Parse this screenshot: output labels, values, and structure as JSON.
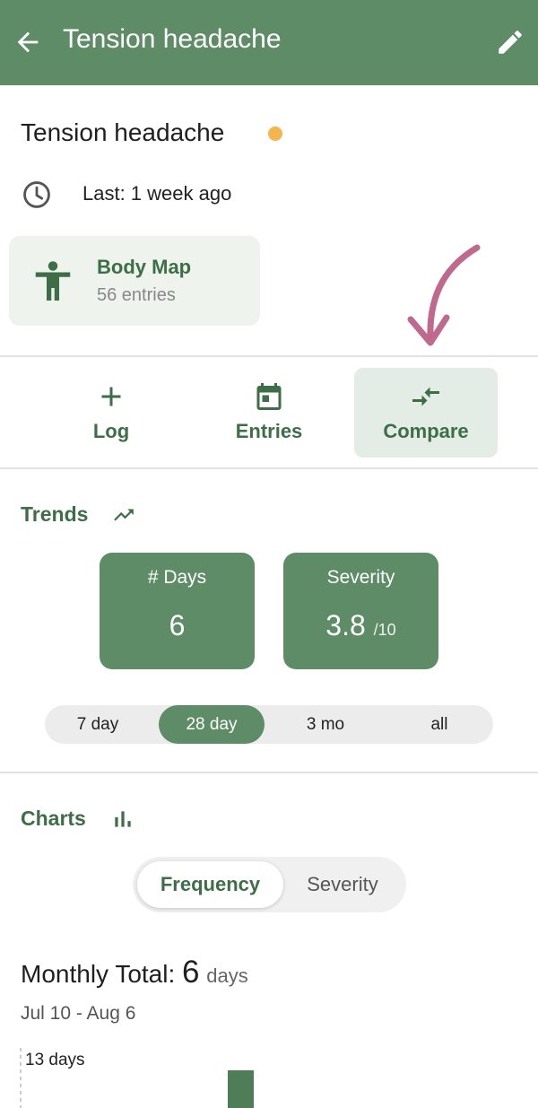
{
  "appbar": {
    "title": "Tension headache",
    "back_icon": "arrow-back-icon",
    "edit_icon": "pencil-icon",
    "color": "#5e8c67"
  },
  "condition": {
    "title": "Tension headache",
    "status_color": "#f6b44f",
    "last_label": "Last: 1 week ago"
  },
  "body_map": {
    "title": "Body Map",
    "subtitle": "56 entries"
  },
  "actions": [
    {
      "label": "Log",
      "icon": "plus-icon",
      "active": false
    },
    {
      "label": "Entries",
      "icon": "calendar-icon",
      "active": false
    },
    {
      "label": "Compare",
      "icon": "compare-arrows-icon",
      "active": true
    }
  ],
  "trends": {
    "title": "Trends",
    "stats": [
      {
        "label": "# Days",
        "value": "6",
        "unit": ""
      },
      {
        "label": "Severity",
        "value": "3.8",
        "unit": "/10"
      }
    ],
    "ranges": [
      "7 day",
      "28 day",
      "3 mo",
      "all"
    ],
    "selected_range": "28 day"
  },
  "charts": {
    "title": "Charts",
    "tabs": [
      "Frequency",
      "Severity"
    ],
    "selected_tab": "Frequency",
    "monthly_label": "Monthly Total:",
    "monthly_value": "6",
    "monthly_unit": "days",
    "date_range": "Jul 10 - Aug 6",
    "axis_max_label": "13 days"
  },
  "colors": {
    "accent": "#5e8c67",
    "accent_text": "#3e6e47",
    "annotation": "#c0698f"
  }
}
